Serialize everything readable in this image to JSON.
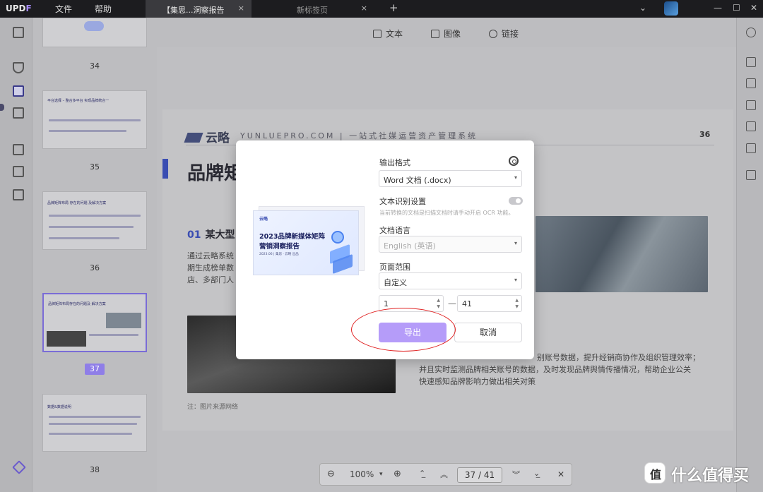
{
  "titlebar": {
    "logo_main": "UPD",
    "logo_accent": "F",
    "menu": [
      "文件",
      "帮助"
    ],
    "tabs": [
      {
        "label": "【集思...洞察报告",
        "close": "×"
      },
      {
        "label": "新标签页",
        "close": "×"
      }
    ],
    "add_tab": "+",
    "controls": [
      "⌄",
      "—",
      "☐",
      "✕"
    ]
  },
  "toolbar": {
    "text": "文本",
    "image": "图像",
    "link": "链接"
  },
  "thumbnails": [
    {
      "page": "34"
    },
    {
      "page": "35",
      "heading": "平台选择 – 整合多平台 实现品牌统合一"
    },
    {
      "page": "36",
      "heading": "品牌矩阵布局 存在的问题 及解决方案"
    },
    {
      "page": "37",
      "heading": "品牌矩阵布局存在的问题及 解决方案",
      "selected": true
    },
    {
      "page": "38",
      "heading": "数据&数据说明"
    }
  ],
  "document": {
    "logo": "云略",
    "subtitle": "YUNLUEPRO.COM | 一站式社媒运营资产管理系统",
    "page_number": "36",
    "title": "品牌矩",
    "section_num": "01",
    "section_title": "某大型",
    "para": [
      "通过云略系统",
      "期生成榜单数",
      "店、多部门人"
    ],
    "caption": "注：图片来源网络",
    "right_para": [
      "别账号数据，提升经销商协作及组织管理效率；",
      "并且实时监测品牌相关账号的数据，及时发现品牌舆情传播情况，帮助企业公关",
      "快速感知品牌影响力做出相关对策"
    ]
  },
  "modal": {
    "preview": {
      "logo": "云略",
      "title_line1": "2023品牌新媒体矩阵",
      "title_line2": "营销洞察报告",
      "meta": "2023.06 | 集思 · 云略 出品"
    },
    "output_format_label": "输出格式",
    "output_format_value": "Word 文档 (.docx)",
    "ocr_label": "文本识别设置",
    "ocr_hint": "当前转换的文档是扫描文档时请手动开启 OCR 功能。",
    "doc_language_label": "文档语言",
    "doc_language_value": "English (英语)",
    "page_range_label": "页面范围",
    "page_range_value": "自定义",
    "range_from": "1",
    "range_to": "41",
    "range_sep": "—",
    "export_button": "导出",
    "cancel_button": "取消"
  },
  "pager": {
    "zoom_out": "⊖",
    "zoom": "100%",
    "zoom_caret": "▾",
    "zoom_in": "⊕",
    "current": "37",
    "sep": "/",
    "total": "41",
    "close": "✕"
  },
  "watermark": {
    "badge": "值",
    "text": "什么值得买"
  },
  "colors": {
    "accent": "#8f7ee8",
    "export_button": "#b59cf9",
    "highlight_circle": "#e02020"
  }
}
